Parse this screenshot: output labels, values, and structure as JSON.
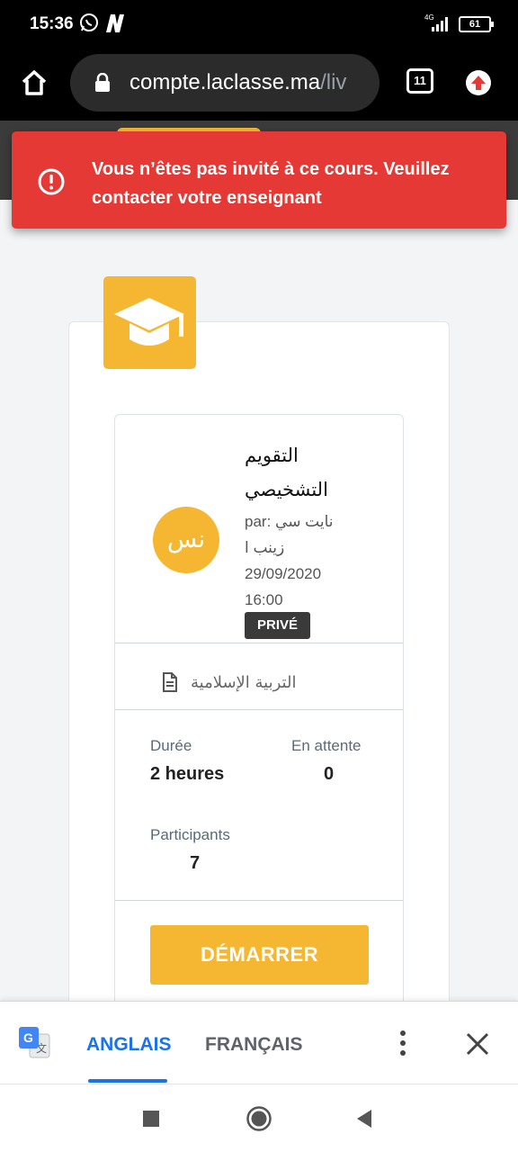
{
  "status_bar": {
    "time": "15:36",
    "battery": "61",
    "network": "4G"
  },
  "browser": {
    "url_main": "compte.laclasse.ma",
    "url_rest": "/liv",
    "tab_count": "11"
  },
  "toast": {
    "message": "Vous n’êtes pas invité à ce cours. Veuillez contacter votre enseignant",
    "color": "#e53935"
  },
  "course": {
    "avatar_text": "نس",
    "title_line1": "التقويم",
    "title_line2": "التشخيصي",
    "author_line1": "par: نايت سي",
    "author_line2": "زينب ا",
    "date": "29/09/2020",
    "time": "16:00",
    "badge": "PRIVÉ",
    "subject": "التربية الإسلامية",
    "stats": {
      "duration_label": "Durée",
      "duration_value": "2 heures",
      "pending_label": "En attente",
      "pending_value": "0",
      "participants_label": "Participants",
      "participants_value": "7"
    },
    "start_label": "DÉMARRER",
    "accent": "#f5b731"
  },
  "translate_bar": {
    "active_lang": "ANGLAIS",
    "other_lang": "FRANÇAIS",
    "accent": "#1a73e8"
  },
  "icons": [
    "home-icon",
    "lock-icon",
    "upload-icon",
    "alert-icon",
    "graduation-cap-icon",
    "document-icon",
    "google-translate-icon",
    "more-vert-icon",
    "close-icon",
    "recents-icon",
    "home-circle-icon",
    "back-icon"
  ]
}
